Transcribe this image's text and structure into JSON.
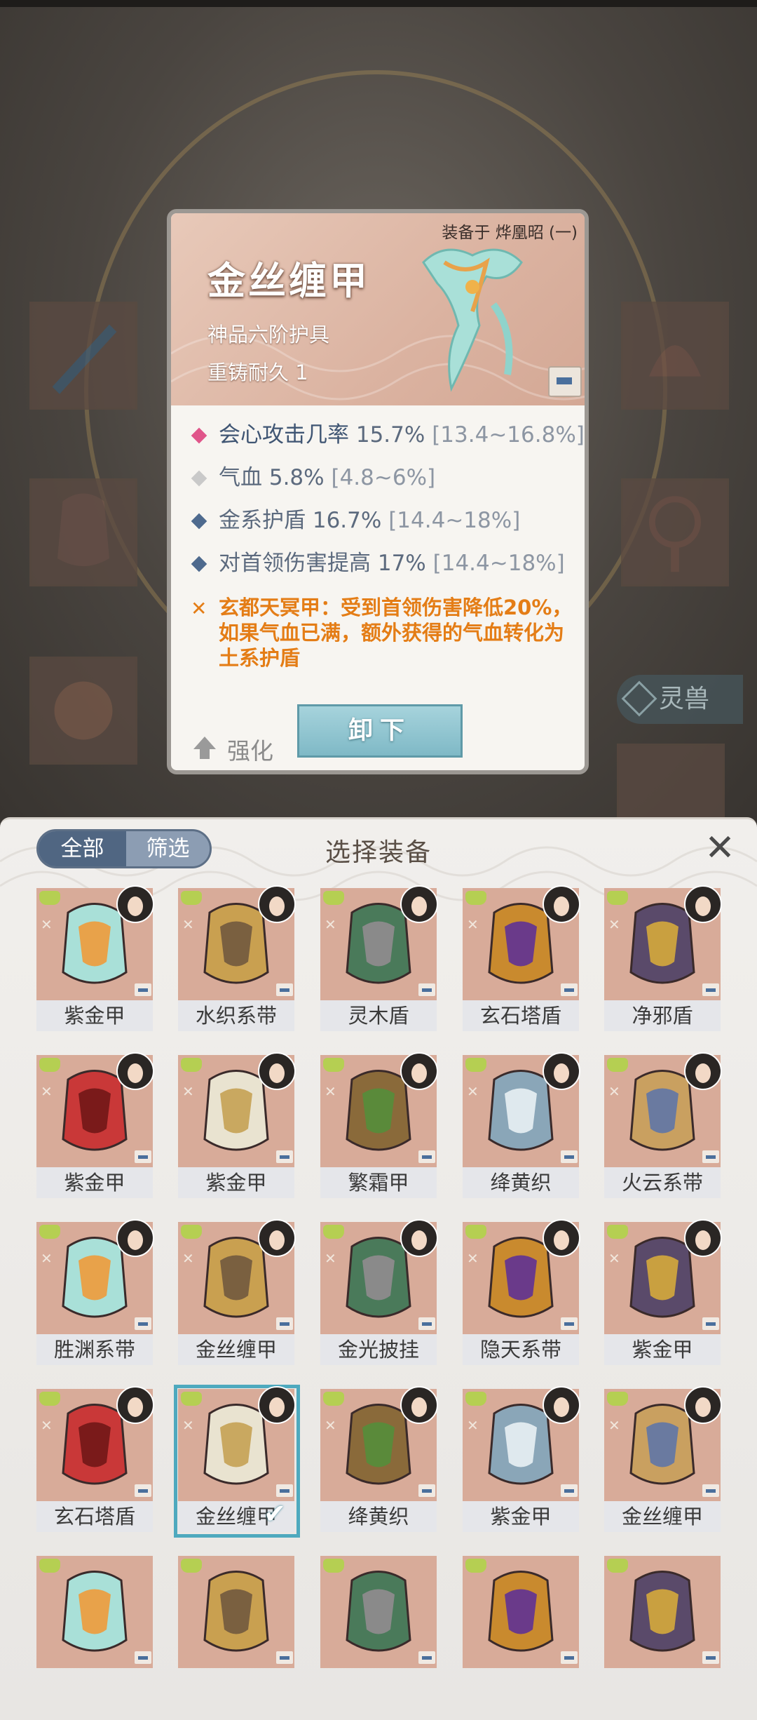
{
  "detail": {
    "equipped_by": "装备于 烨凰昭 (一)",
    "name": "金丝缠甲",
    "grade": "神品六阶护具",
    "recast": "重铸耐久 1",
    "stats": [
      {
        "label": "会心攻击几率",
        "value": "15.7%",
        "range": "[13.4~16.8%]",
        "color": "#e0558a"
      },
      {
        "label": "气血",
        "value": "5.8%",
        "range": "[4.8~6%]",
        "color": "#c9c9c9"
      },
      {
        "label": "金系护盾",
        "value": "16.7%",
        "range": "[14.4~18%]",
        "color": "#4e6a8e"
      },
      {
        "label": "对首领伤害提高",
        "value": "17%",
        "range": "[14.4~18%]",
        "color": "#4e6a8e"
      }
    ],
    "special": "玄都天冥甲：受到首领伤害降低20%，如果气血已满，额外获得的气血转化为土系护盾",
    "enhance_label": "强化",
    "unequip_label": "卸下"
  },
  "background": {
    "lingshou_label": "灵兽"
  },
  "panel": {
    "title": "选择装备",
    "tab_all": "全部",
    "tab_filter": "筛选",
    "close_glyph": "✕",
    "items": [
      {
        "name": "紫金甲"
      },
      {
        "name": "水织系带"
      },
      {
        "name": "灵木盾"
      },
      {
        "name": "玄石塔盾"
      },
      {
        "name": "净邪盾"
      },
      {
        "name": "紫金甲"
      },
      {
        "name": "紫金甲"
      },
      {
        "name": "繁霜甲"
      },
      {
        "name": "绛黄织"
      },
      {
        "name": "火云系带"
      },
      {
        "name": "胜渊系带"
      },
      {
        "name": "金丝缠甲"
      },
      {
        "name": "金光披挂"
      },
      {
        "name": "隐天系带"
      },
      {
        "name": "紫金甲"
      },
      {
        "name": "玄石塔盾"
      },
      {
        "name": "金丝缠甲",
        "selected": true
      },
      {
        "name": "绛黄织"
      },
      {
        "name": "紫金甲"
      },
      {
        "name": "金丝缠甲"
      },
      {
        "name": ""
      },
      {
        "name": ""
      },
      {
        "name": ""
      },
      {
        "name": ""
      },
      {
        "name": ""
      }
    ]
  }
}
